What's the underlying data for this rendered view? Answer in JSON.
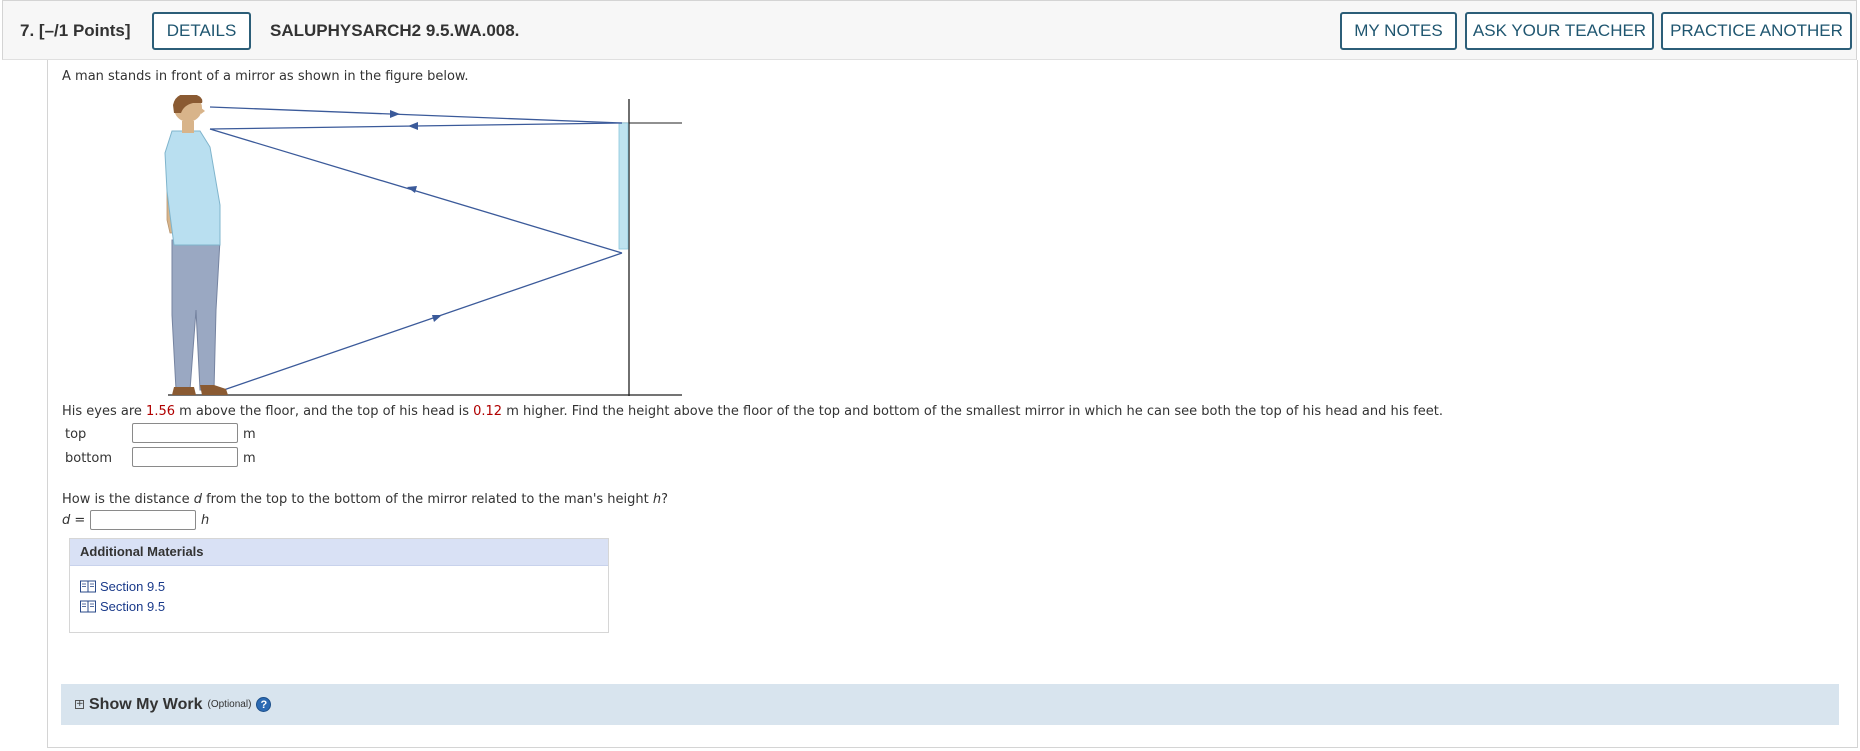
{
  "header": {
    "question_number": "7.",
    "points": "[–/1 Points]",
    "details_label": "DETAILS",
    "problem_code": "SALUPHYSARCH2 9.5.WA.008.",
    "my_notes_label": "MY NOTES",
    "ask_teacher_label": "ASK YOUR TEACHER",
    "practice_another_label": "PRACTICE ANOTHER"
  },
  "question": {
    "intro": "A man stands in front of a mirror as shown in the figure below.",
    "stem_part1": "His eyes are ",
    "eye_height": "1.56",
    "stem_part2": " m above the floor, and the top of his head is ",
    "head_extra": "0.12",
    "stem_part3": " m higher. Find the height above the floor of the top and bottom of the smallest mirror in which he can see both the top of his head and his feet.",
    "top_label": "top",
    "top_value": "",
    "top_unit": "m",
    "bottom_label": "bottom",
    "bottom_value": "",
    "bottom_unit": "m",
    "q2_part1": "How is the distance ",
    "q2_d": "d",
    "q2_part2": " from the top to the bottom of the mirror related to the man's height ",
    "q2_h": "h",
    "q2_part3": "?",
    "d_label": "d",
    "d_eq": " =",
    "d_value": "",
    "d_unit": "h"
  },
  "additional_materials": {
    "title": "Additional Materials",
    "links": [
      {
        "label": "Section 9.5",
        "icon": "book-icon"
      },
      {
        "label": "Section 9.5",
        "icon": "book-icon"
      }
    ]
  },
  "show_my_work": {
    "label": "Show My Work",
    "optional": "(Optional)",
    "help_symbol": "?"
  },
  "colors": {
    "button_border": "#2c5e78",
    "value_red": "#b00000",
    "ray_blue": "#3b5a9a",
    "shirt": "#b9dff0",
    "pants": "#9aa8c2",
    "mirror": "#bfe3f0",
    "materials_header": "#d9e1f5",
    "show_work_bg": "#d8e4ee"
  }
}
